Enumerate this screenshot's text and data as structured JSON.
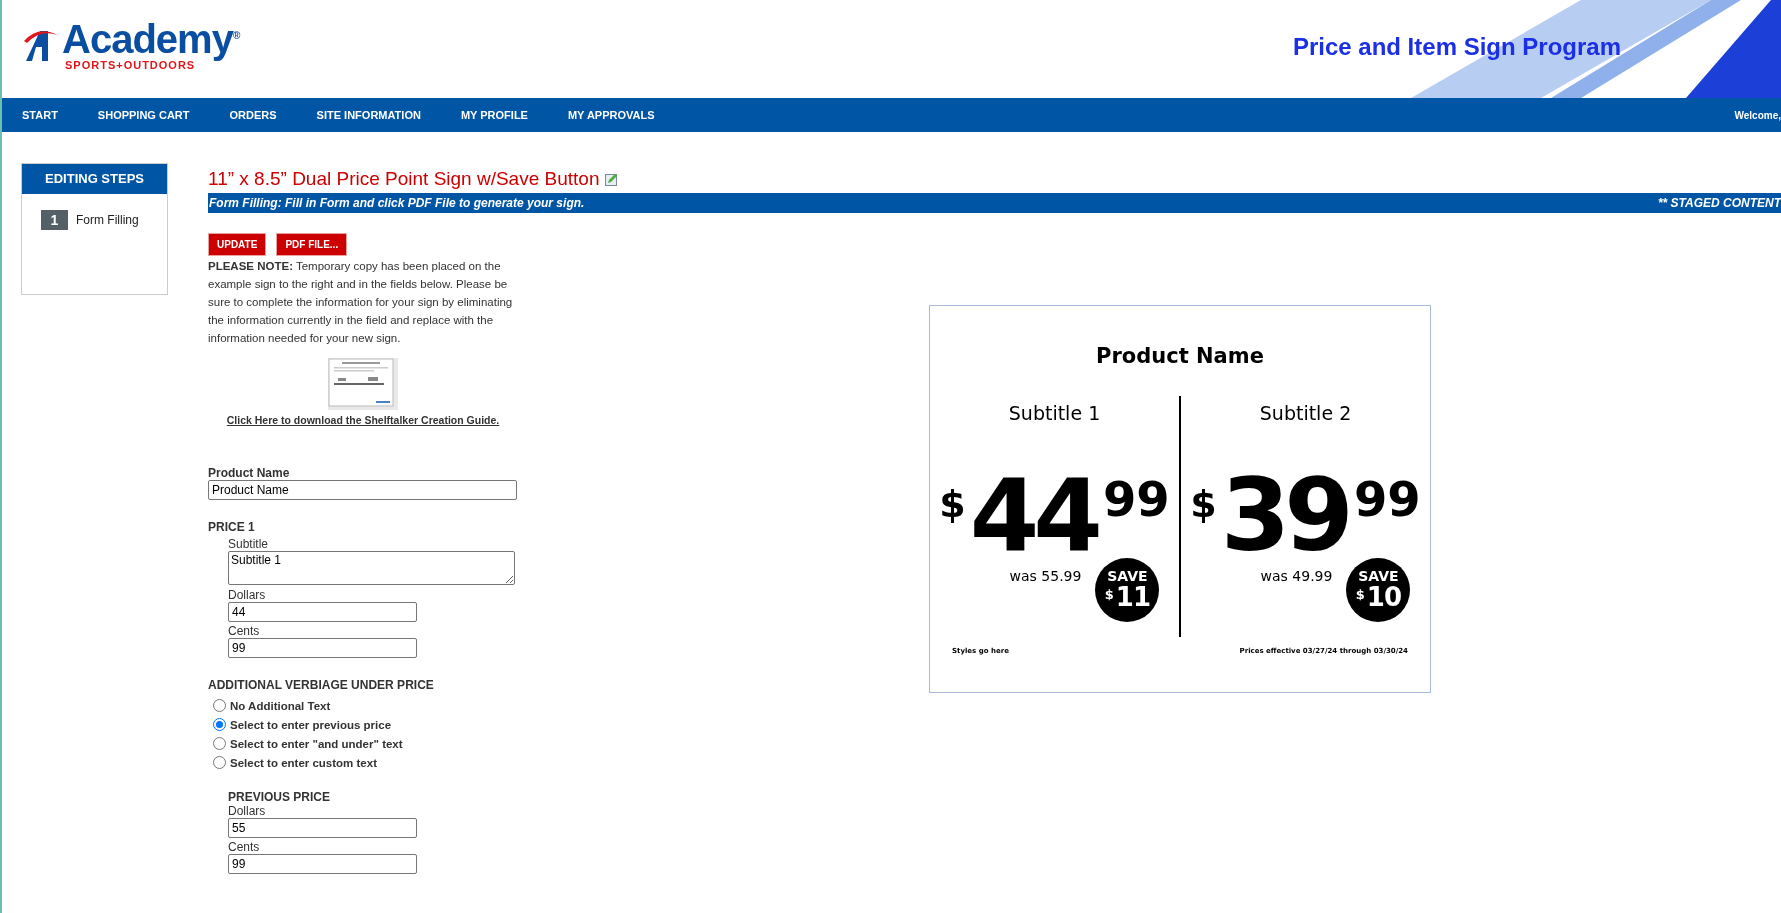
{
  "header": {
    "logo": {
      "name": "Academy$^{®}$",
      "tagline": "SPORTS+OUTDOORS"
    },
    "title": "Price and Item Sign Program"
  },
  "nav": {
    "items": [
      "START",
      "SHOPPING CART",
      "ORDERS",
      "SITE INFORMATION",
      "MY PROFILE",
      "MY APPROVALS"
    ],
    "welcome": "Welcome,"
  },
  "sidebar": {
    "title": "EDITING STEPS",
    "steps": [
      {
        "number": "1",
        "label": "Form Filling"
      }
    ]
  },
  "page": {
    "title": "11” x 8.5” Dual Price Point Sign w/Save Button",
    "instruction": "Form Filling: Fill in Form and click PDF File to generate your sign.",
    "status": "** STAGED CONTENT",
    "buttons": [
      "UPDATE",
      "PDF FILE..."
    ]
  },
  "note": "**PLEASE NOTE:** Temporary copy has been placed on the example sign to the right and in the fields below. Please be sure to complete the information for your sign by eliminating the information currently in the field and replace with the information needed for your new sign.",
  "guide_link": "Click Here to download the Shelftalker Creation Guide.",
  "form": {
    "product_name": {
      "label": "Product Name",
      "value": "Product Name"
    },
    "price_1": {
      "heading": "PRICE 1",
      "subtitle": {
        "label": "Subtitle",
        "value": "Subtitle 1"
      },
      "dollars": {
        "label": "Dollars",
        "value": "44"
      },
      "cents": {
        "label": "Cents",
        "value": "99"
      }
    },
    "verbiage": {
      "heading": "ADDITIONAL VERBIAGE UNDER PRICE",
      "options": [
        {
          "label": "No Additional Text",
          "selected": false
        },
        {
          "label": "Select to enter previous price",
          "selected": true
        },
        {
          "label": "Select to enter \"and under\" text",
          "selected": false
        },
        {
          "label": "Select to enter custom text",
          "selected": false
        }
      ]
    },
    "previous_price": {
      "heading": "PREVIOUS PRICE",
      "dollars": {
        "label": "Dollars",
        "value": "55"
      },
      "cents": {
        "label": "Cents",
        "value": "99"
      }
    }
  },
  "sign": {
    "product_name": "Product Name",
    "panels": [
      {
        "subtitle": "Subtitle 1",
        "currency": "$",
        "dollars": "44",
        "cents": "99",
        "was": "was 55.99",
        "save_label": "SAVE",
        "save_currency": "$",
        "save_amount": "11"
      },
      {
        "subtitle": "Subtitle 2",
        "currency": "$",
        "dollars": "39",
        "cents": "99",
        "was": "was 49.99",
        "save_label": "SAVE",
        "save_currency": "$",
        "save_amount": "10"
      }
    ],
    "footer_left": "Styles go here",
    "footer_right": "Prices effective 03/27/24 through 03/30/24"
  }
}
